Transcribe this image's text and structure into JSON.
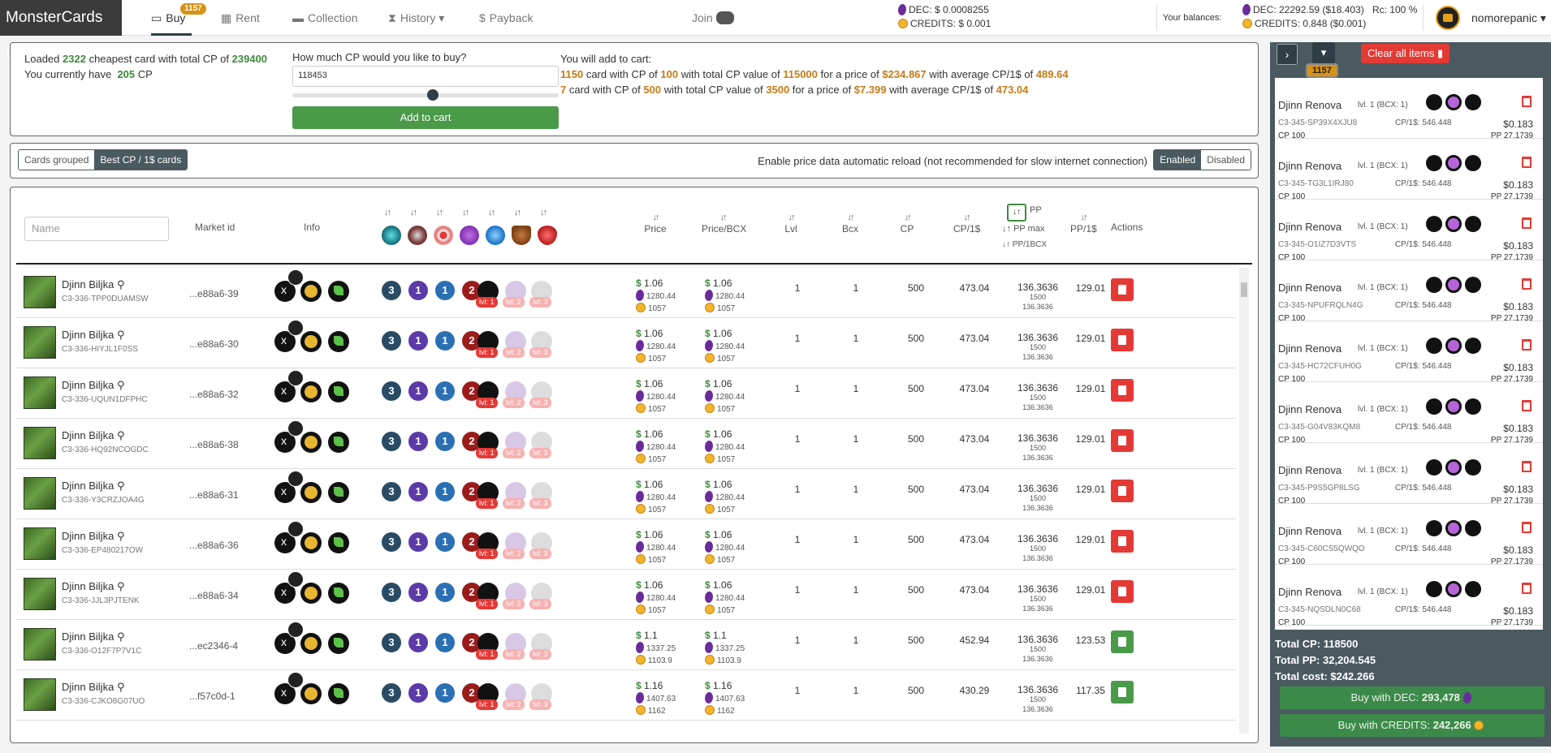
{
  "brand": "MonsterCards",
  "nav": {
    "buy": "Buy",
    "buy_badge": "1157",
    "rent": "Rent",
    "collection": "Collection",
    "history": "History",
    "payback": "Payback",
    "join": "Join"
  },
  "prices": {
    "dec": "DEC: $ 0.0008255",
    "credits": "CREDITS: $ 0.001"
  },
  "balances": {
    "label": "Your balances:",
    "dec": "DEC: 22292.59 ($18.403)",
    "credits": "CREDITS: 0.848 ($0.001)",
    "rc": "Rc: 100 %",
    "user": "nomorepanic"
  },
  "loader": {
    "line1_pre": "Loaded",
    "count": "2322",
    "line1_mid": "cheapest card with total CP of",
    "total_cp": "239400",
    "line2_pre": "You currently have",
    "have_cp": "205",
    "line2_post": "CP"
  },
  "buy_cp": {
    "question": "How much CP would you like to buy?",
    "value": "118453",
    "slider_fraction": 0.49,
    "button": "Add to cart"
  },
  "summary": {
    "header": "You will add to cart:",
    "line1": {
      "count": "1150",
      "cp": "100",
      "total": "115000",
      "price": "$234.867",
      "avg": "489.64"
    },
    "line2": {
      "count": "7",
      "cp": "500",
      "total": "3500",
      "price": "$7.399",
      "avg": "473.04"
    },
    "t1": "card with CP of",
    "t2": "with total CP value of",
    "t3": "for a price of",
    "t4": "with average CP/1$ of"
  },
  "toggles": {
    "grouped": "Cards grouped",
    "best": "Best CP / 1$ cards",
    "reload_label": "Enable price data automatic reload (not recommended for slow internet connection)",
    "enabled": "Enabled",
    "disabled": "Disabled"
  },
  "table": {
    "name_placeholder": "Name",
    "headers": {
      "market": "Market id",
      "info": "Info",
      "price": "Price",
      "price_bcx": "Price/BCX",
      "lvl": "Lvl",
      "bcx": "Bcx",
      "cp": "CP",
      "cp1": "CP/1$",
      "pp": "PP",
      "ppmax": "PP max",
      "pp1bcx": "PP/1BCX",
      "pp1": "PP/1$",
      "actions": "Actions"
    },
    "sort_glyph": "↓↑",
    "lvl_labels": [
      "lvl: 1",
      "lvl: 2",
      "lvl: 3"
    ],
    "rows": [
      {
        "name": "Djinn Biljka",
        "id": "C3-336-TPP0DUAMSW",
        "market": "...e88a6-39",
        "price": "1.06",
        "dec": "1280.44",
        "cr": "1057",
        "pbcx": "1.06",
        "pdec": "1280.44",
        "pcr": "1057",
        "lvl": "1",
        "bcx": "1",
        "cp": "500",
        "cp1": "473.04",
        "pp": "136.3636",
        "ppmax": "1500",
        "pp1bcx": "136.3636",
        "pp1": "129.01",
        "action": "remove"
      },
      {
        "name": "Djinn Biljka",
        "id": "C3-336-HIYJL1F0SS",
        "market": "...e88a6-30",
        "price": "1.06",
        "dec": "1280.44",
        "cr": "1057",
        "pbcx": "1.06",
        "pdec": "1280.44",
        "pcr": "1057",
        "lvl": "1",
        "bcx": "1",
        "cp": "500",
        "cp1": "473.04",
        "pp": "136.3636",
        "ppmax": "1500",
        "pp1bcx": "136.3636",
        "pp1": "129.01",
        "action": "remove"
      },
      {
        "name": "Djinn Biljka",
        "id": "C3-336-UQUN1DFPHC",
        "market": "...e88a6-32",
        "price": "1.06",
        "dec": "1280.44",
        "cr": "1057",
        "pbcx": "1.06",
        "pdec": "1280.44",
        "pcr": "1057",
        "lvl": "1",
        "bcx": "1",
        "cp": "500",
        "cp1": "473.04",
        "pp": "136.3636",
        "ppmax": "1500",
        "pp1bcx": "136.3636",
        "pp1": "129.01",
        "action": "remove"
      },
      {
        "name": "Djinn Biljka",
        "id": "C3-336-HQ92NCOGDC",
        "market": "...e88a6-38",
        "price": "1.06",
        "dec": "1280.44",
        "cr": "1057",
        "pbcx": "1.06",
        "pdec": "1280.44",
        "pcr": "1057",
        "lvl": "1",
        "bcx": "1",
        "cp": "500",
        "cp1": "473.04",
        "pp": "136.3636",
        "ppmax": "1500",
        "pp1bcx": "136.3636",
        "pp1": "129.01",
        "action": "remove"
      },
      {
        "name": "Djinn Biljka",
        "id": "C3-336-Y3CRZJOA4G",
        "market": "...e88a6-31",
        "price": "1.06",
        "dec": "1280.44",
        "cr": "1057",
        "pbcx": "1.06",
        "pdec": "1280.44",
        "pcr": "1057",
        "lvl": "1",
        "bcx": "1",
        "cp": "500",
        "cp1": "473.04",
        "pp": "136.3636",
        "ppmax": "1500",
        "pp1bcx": "136.3636",
        "pp1": "129.01",
        "action": "remove"
      },
      {
        "name": "Djinn Biljka",
        "id": "C3-336-EP480217OW",
        "market": "...e88a6-36",
        "price": "1.06",
        "dec": "1280.44",
        "cr": "1057",
        "pbcx": "1.06",
        "pdec": "1280.44",
        "pcr": "1057",
        "lvl": "1",
        "bcx": "1",
        "cp": "500",
        "cp1": "473.04",
        "pp": "136.3636",
        "ppmax": "1500",
        "pp1bcx": "136.3636",
        "pp1": "129.01",
        "action": "remove"
      },
      {
        "name": "Djinn Biljka",
        "id": "C3-336-JJL3PJTENK",
        "market": "...e88a6-34",
        "price": "1.06",
        "dec": "1280.44",
        "cr": "1057",
        "pbcx": "1.06",
        "pdec": "1280.44",
        "pcr": "1057",
        "lvl": "1",
        "bcx": "1",
        "cp": "500",
        "cp1": "473.04",
        "pp": "136.3636",
        "ppmax": "1500",
        "pp1bcx": "136.3636",
        "pp1": "129.01",
        "action": "remove"
      },
      {
        "name": "Djinn Biljka",
        "id": "C3-336-O12F7P7V1C",
        "market": "...ec2346-4",
        "price": "1.1",
        "dec": "1337.25",
        "cr": "1103.9",
        "pbcx": "1.1",
        "pdec": "1337.25",
        "pcr": "1103.9",
        "lvl": "1",
        "bcx": "1",
        "cp": "500",
        "cp1": "452.94",
        "pp": "136.3636",
        "ppmax": "1500",
        "pp1bcx": "136.3636",
        "pp1": "123.53",
        "action": "add"
      },
      {
        "name": "Djinn Biljka",
        "id": "C3-336-CJKO8G07UO",
        "market": "...f57c0d-1",
        "price": "1.16",
        "dec": "1407.63",
        "cr": "1162",
        "pbcx": "1.16",
        "pdec": "1407.63",
        "pcr": "1162",
        "lvl": "1",
        "bcx": "1",
        "cp": "500",
        "cp1": "430.29",
        "pp": "136.3636",
        "ppmax": "1500",
        "pp1bcx": "136.3636",
        "pp1": "117.35",
        "action": "add"
      }
    ]
  },
  "cart": {
    "badge": "1157",
    "clear": "Clear all items",
    "items": [
      {
        "name": "Djinn Renova",
        "lvl": "lvl. 1 (BCX: 1)",
        "code": "C3-345-SP39X4XJU8",
        "ratio": "CP/1$: 546.448",
        "price": "$0.183",
        "cp": "CP 100",
        "pp": "PP 27.1739"
      },
      {
        "name": "Djinn Renova",
        "lvl": "lvl. 1 (BCX: 1)",
        "code": "C3-345-TG3L1IRJ80",
        "ratio": "CP/1$: 546.448",
        "price": "$0.183",
        "cp": "CP 100",
        "pp": "PP 27.1739"
      },
      {
        "name": "Djinn Renova",
        "lvl": "lvl. 1 (BCX: 1)",
        "code": "C3-345-O1IZ7D3VTS",
        "ratio": "CP/1$: 546.448",
        "price": "$0.183",
        "cp": "CP 100",
        "pp": "PP 27.1739"
      },
      {
        "name": "Djinn Renova",
        "lvl": "lvl. 1 (BCX: 1)",
        "code": "C3-345-NPUFRQLN4G",
        "ratio": "CP/1$: 546.448",
        "price": "$0.183",
        "cp": "CP 100",
        "pp": "PP 27.1739"
      },
      {
        "name": "Djinn Renova",
        "lvl": "lvl. 1 (BCX: 1)",
        "code": "C3-345-HC72CFUH0G",
        "ratio": "CP/1$: 546.448",
        "price": "$0.183",
        "cp": "CP 100",
        "pp": "PP 27.1739"
      },
      {
        "name": "Djinn Renova",
        "lvl": "lvl. 1 (BCX: 1)",
        "code": "C3-345-G04V83KQM8",
        "ratio": "CP/1$: 546.448",
        "price": "$0.183",
        "cp": "CP 100",
        "pp": "PP 27.1739"
      },
      {
        "name": "Djinn Renova",
        "lvl": "lvl. 1 (BCX: 1)",
        "code": "C3-345-P9S5GP8LSG",
        "ratio": "CP/1$: 546.448",
        "price": "$0.183",
        "cp": "CP 100",
        "pp": "PP 27.1739"
      },
      {
        "name": "Djinn Renova",
        "lvl": "lvl. 1 (BCX: 1)",
        "code": "C3-345-C60CS5QWQO",
        "ratio": "CP/1$: 546.448",
        "price": "$0.183",
        "cp": "CP 100",
        "pp": "PP 27.1739"
      },
      {
        "name": "Djinn Renova",
        "lvl": "lvl. 1 (BCX: 1)",
        "code": "C3-345-NQSDLN0C68",
        "ratio": "CP/1$: 546.448",
        "price": "$0.183",
        "cp": "CP 100",
        "pp": "PP 27.1739"
      }
    ],
    "total_cp": "Total CP: 118500",
    "total_pp": "Total PP: 32,204.545",
    "total_cost": "Total cost: $242.266",
    "buy_dec_label": "Buy with DEC:",
    "buy_dec_amount": "293,478",
    "buy_credits_label": "Buy with CREDITS:",
    "buy_credits_amount": "242,266"
  }
}
